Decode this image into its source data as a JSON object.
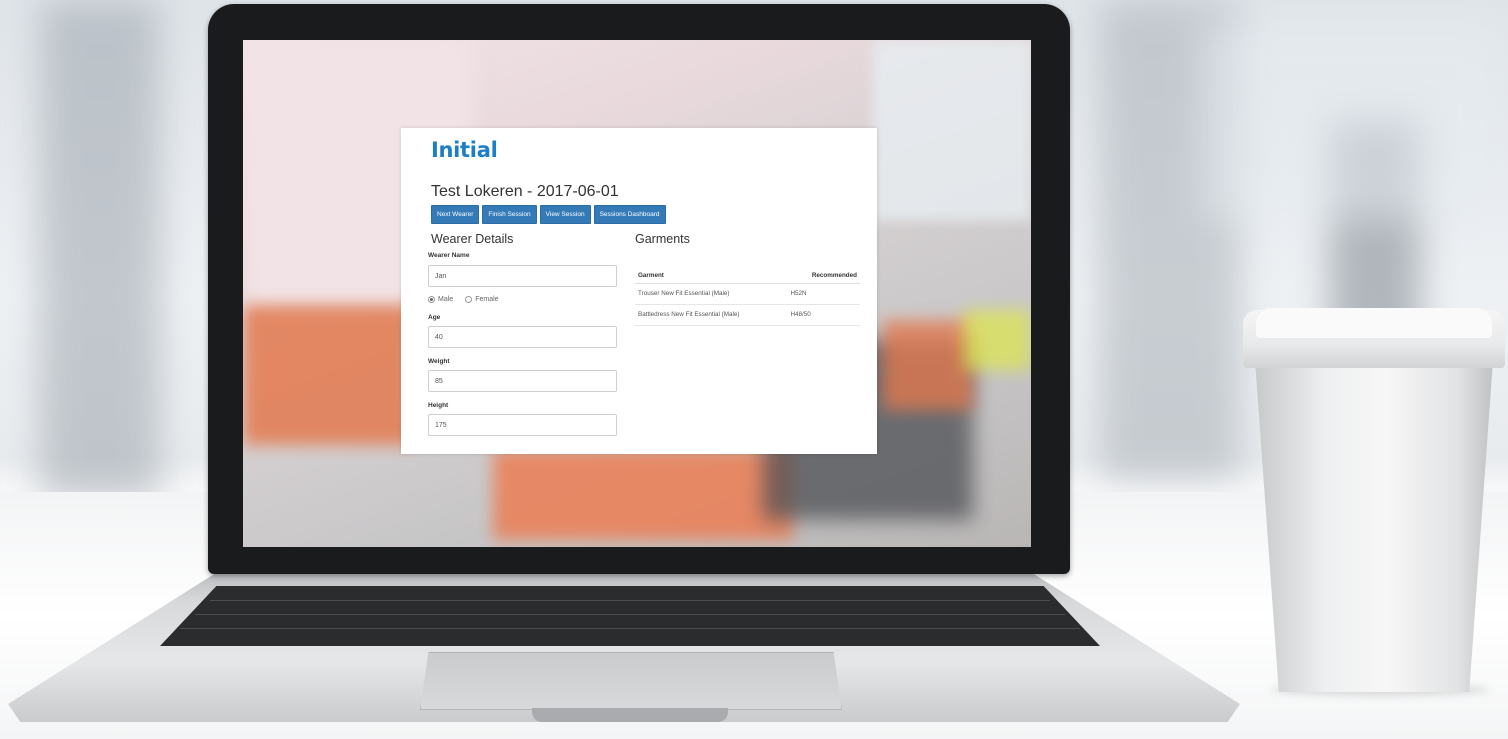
{
  "app": {
    "logo": "Initial",
    "session_title": "Test Lokeren - 2017-06-01",
    "brand_color": "#1c7ec7",
    "button_color": "#337ab7"
  },
  "toolbar": {
    "next_wearer": "Next Wearer",
    "finish_session": "Finish Session",
    "view_session": "View Session",
    "sessions_dashboard": "Sessions Dashboard"
  },
  "wearer": {
    "section_title": "Wearer Details",
    "name_label": "Wearer Name",
    "name_value": "Jan",
    "gender_options": [
      "Male",
      "Female"
    ],
    "gender_selected": "Male",
    "age_label": "Age",
    "age_value": "40",
    "weight_label": "Weight",
    "weight_value": "85",
    "height_label": "Height",
    "height_value": "175"
  },
  "garments": {
    "section_title": "Garments",
    "columns": [
      "Garment",
      "Recommended"
    ],
    "rows": [
      {
        "garment": "Trouser New Fit Essential (Male)",
        "recommended": "H52N"
      },
      {
        "garment": "Battledress New Fit Essential (Male)",
        "recommended": "H48/50"
      }
    ]
  }
}
